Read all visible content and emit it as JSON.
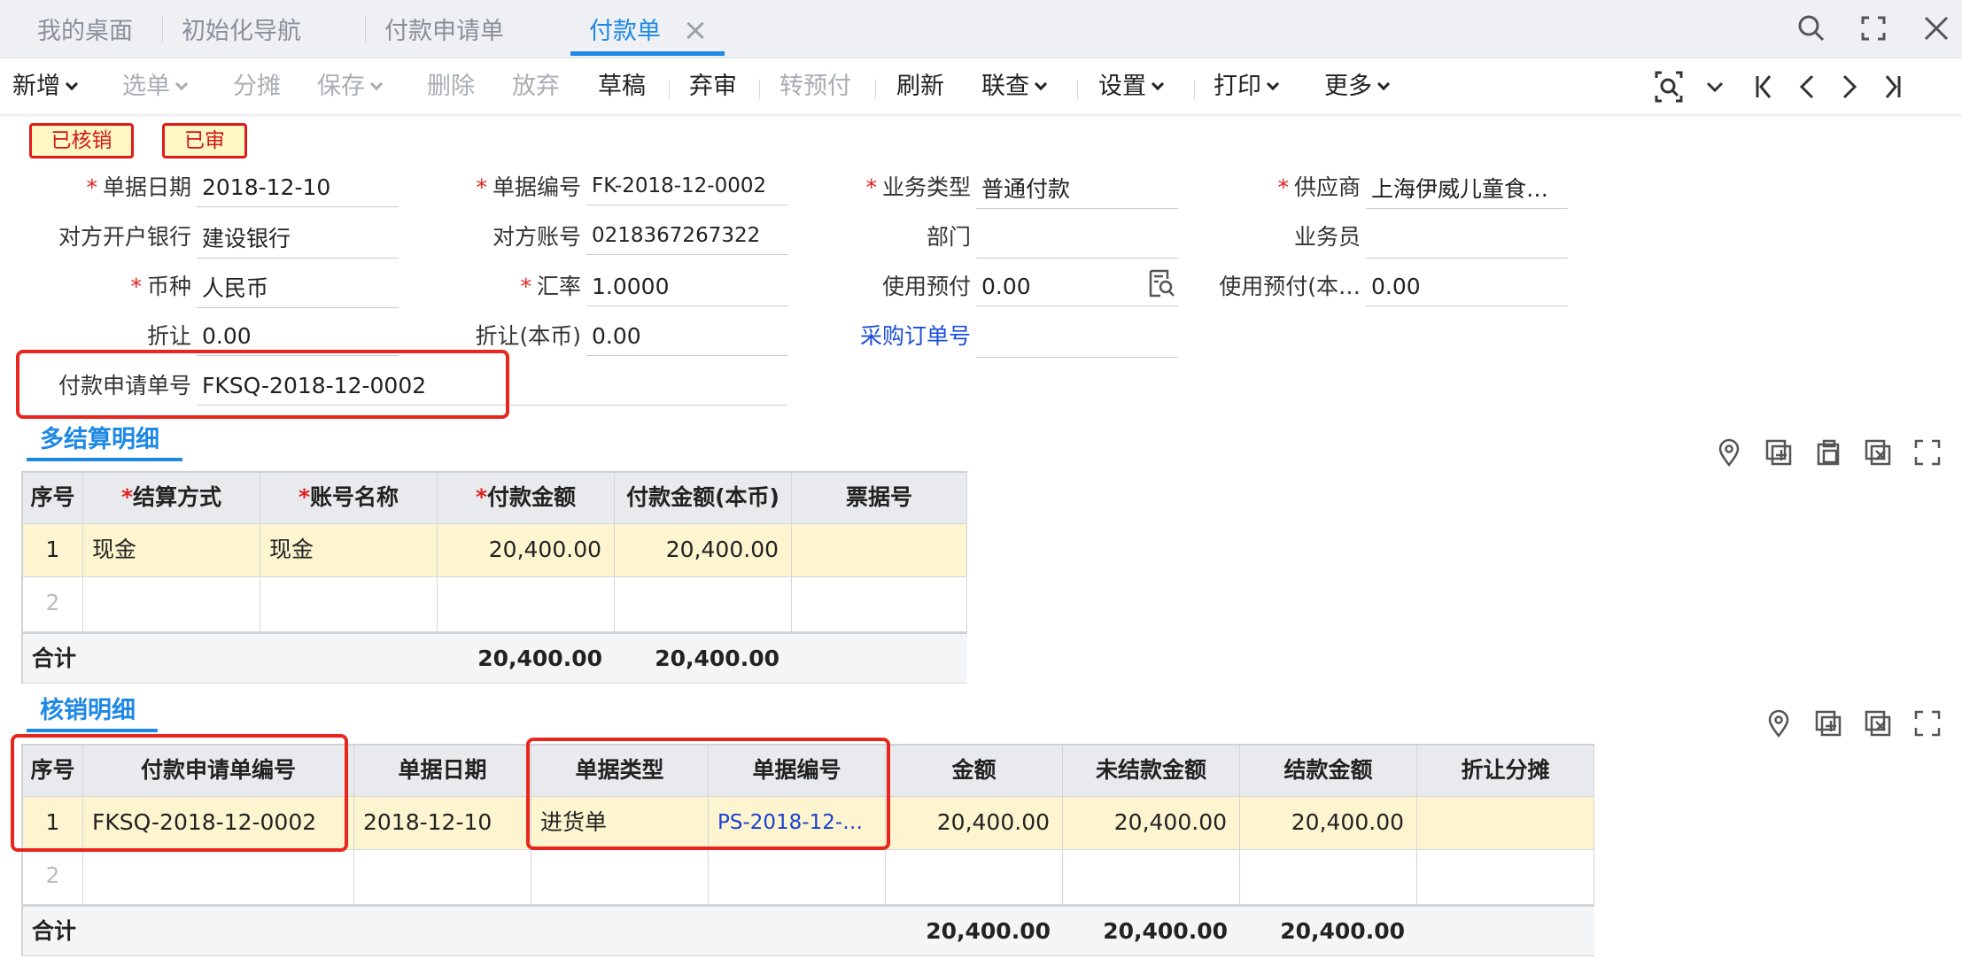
{
  "tabs": [
    {
      "label": "我的桌面"
    },
    {
      "label": "初始化导航"
    },
    {
      "label": "付款申请单"
    },
    {
      "label": "付款单"
    }
  ],
  "toolbar": {
    "add": "新增",
    "select": "选单",
    "split": "分摊",
    "save": "保存",
    "delete": "删除",
    "discard": "放弃",
    "draft": "草稿",
    "unaudit": "弃审",
    "to_prepay": "转预付",
    "refresh": "刷新",
    "linked_query": "联查",
    "settings": "设置",
    "print": "打印",
    "more": "更多"
  },
  "status": {
    "written_off": "已核销",
    "audited": "已审"
  },
  "form": {
    "doc_date": {
      "label": "单据日期",
      "value": "2018-12-10"
    },
    "doc_no": {
      "label": "单据编号",
      "value": "FK-2018-12-0002"
    },
    "biz_type": {
      "label": "业务类型",
      "value": "普通付款"
    },
    "supplier": {
      "label": "供应商",
      "value": "上海伊威儿童食…"
    },
    "bank": {
      "label": "对方开户银行",
      "value": "建设银行"
    },
    "account": {
      "label": "对方账号",
      "value": "0218367267322"
    },
    "dept": {
      "label": "部门",
      "value": ""
    },
    "salesman": {
      "label": "业务员",
      "value": ""
    },
    "currency": {
      "label": "币种",
      "value": "人民币"
    },
    "rate": {
      "label": "汇率",
      "value": "1.0000"
    },
    "use_prepay": {
      "label": "使用预付",
      "value": "0.00"
    },
    "use_prepay_local": {
      "label": "使用预付(本…",
      "value": "0.00"
    },
    "discount": {
      "label": "折让",
      "value": "0.00"
    },
    "discount_local": {
      "label": "折让(本币)",
      "value": "0.00"
    },
    "po_no": {
      "label": "采购订单号",
      "value": ""
    },
    "pay_request_no": {
      "label": "付款申请单号",
      "value": "FKSQ-2018-12-0002"
    }
  },
  "settlement": {
    "title": "多结算明细",
    "headers": [
      "序号",
      "结算方式",
      "账号名称",
      "付款金额",
      "付款金额(本币)",
      "票据号"
    ],
    "rows": [
      [
        "1",
        "现金",
        "现金",
        "20,400.00",
        "20,400.00",
        ""
      ],
      [
        "2",
        "",
        "",
        "",
        "",
        ""
      ]
    ],
    "total": {
      "label": "合计",
      "amount": "20,400.00",
      "amount_local": "20,400.00"
    }
  },
  "writeoff": {
    "title": "核销明细",
    "headers": [
      "序号",
      "付款申请单编号",
      "单据日期",
      "单据类型",
      "单据编号",
      "金额",
      "未结款金额",
      "结款金额",
      "折让分摊"
    ],
    "rows": [
      [
        "1",
        "FKSQ-2018-12-0002",
        "2018-12-10",
        "进货单",
        "PS-2018-12-…",
        "20,400.00",
        "20,400.00",
        "20,400.00",
        ""
      ],
      [
        "2",
        "",
        "",
        "",
        "",
        "",
        "",
        "",
        ""
      ]
    ],
    "total": {
      "label": "合计",
      "amount": "20,400.00",
      "unsettled": "20,400.00",
      "settled": "20,400.00"
    }
  },
  "colors": {
    "accent": "#1e88e5",
    "highlight_border": "#e8261e",
    "required": "#e02020",
    "row_selected": "#fdf5cf",
    "link": "#1a3fd0"
  }
}
